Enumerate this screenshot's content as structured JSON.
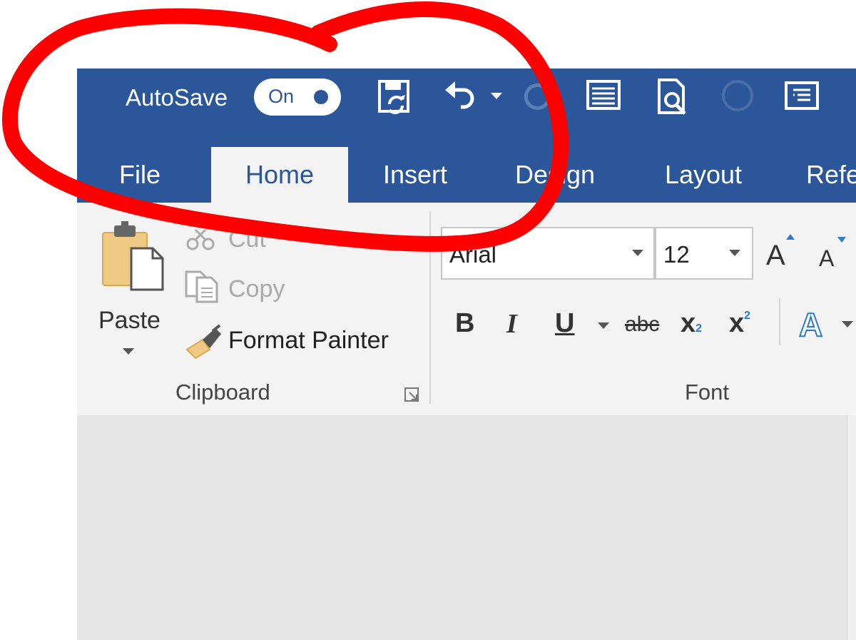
{
  "quick_access": {
    "autosave_label": "AutoSave",
    "autosave_state": "On",
    "icons": [
      "save-sync-icon",
      "undo-icon",
      "undo-dropdown-icon",
      "redo-icon",
      "print-layout-icon",
      "print-preview-icon",
      "circle-icon",
      "read-mode-icon"
    ]
  },
  "tabs": [
    {
      "label": "File"
    },
    {
      "label": "Home"
    },
    {
      "label": "Insert"
    },
    {
      "label": "Design"
    },
    {
      "label": "Layout"
    },
    {
      "label": "Refe"
    }
  ],
  "active_tab": "Home",
  "clipboard": {
    "paste_label": "Paste",
    "cut_label": "Cut",
    "copy_label": "Copy",
    "format_painter_label": "Format Painter",
    "group_label": "Clipboard"
  },
  "font": {
    "font_name": "Arial",
    "font_size": "12",
    "grow_label": "A",
    "shrink_label": "A",
    "bold_label": "B",
    "italic_label": "I",
    "underline_label": "U",
    "strike_label": "abc",
    "subscript_label": "x",
    "subscript_sub": "2",
    "superscript_label": "x",
    "superscript_sup": "2",
    "text_effects_label": "A",
    "group_label": "Font"
  },
  "colors": {
    "brand_blue": "#2b579a",
    "ribbon_bg": "#f3f3f3",
    "annotation_red": "#ff0000"
  }
}
